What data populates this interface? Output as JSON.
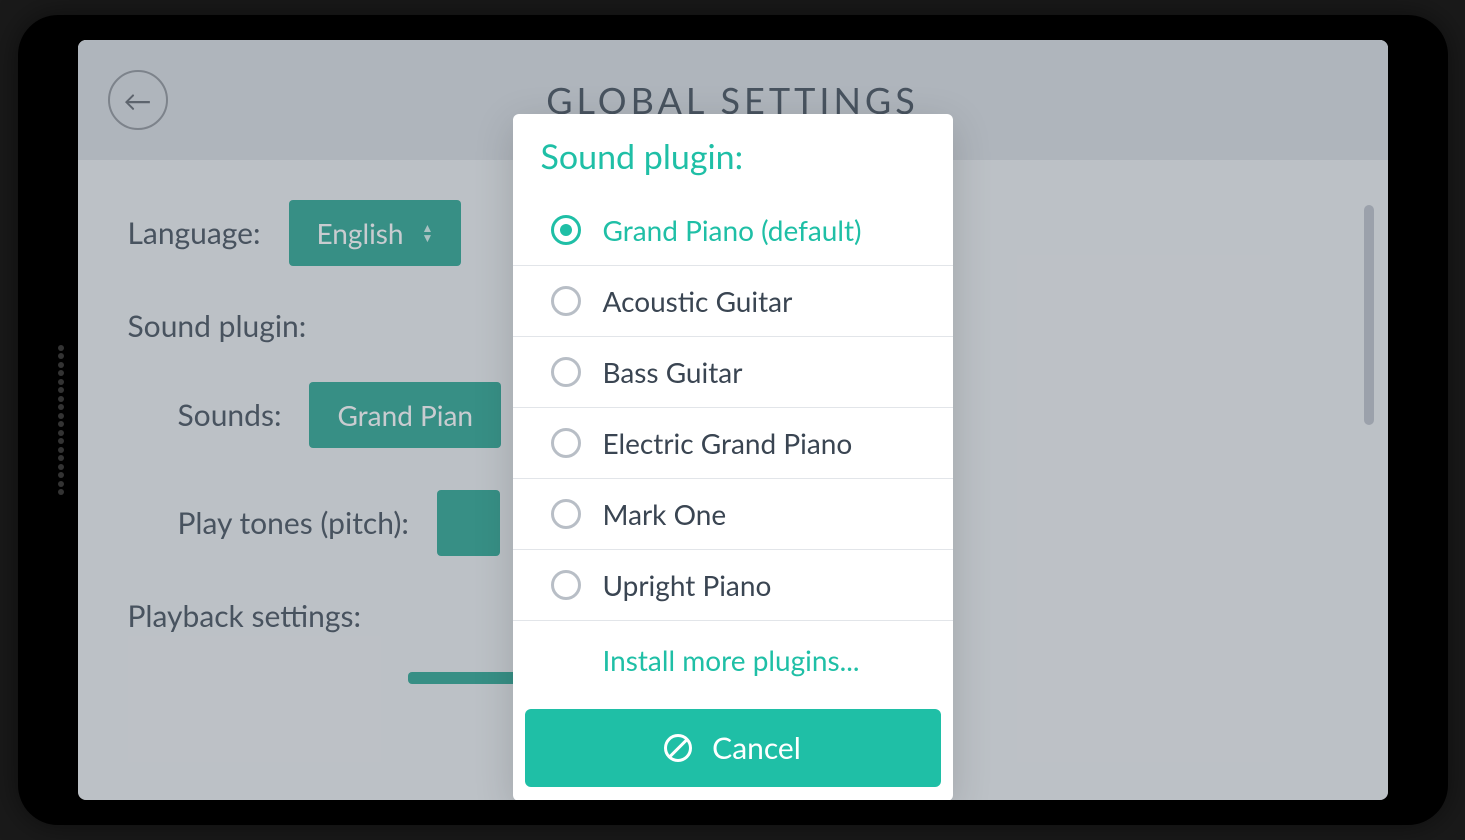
{
  "pageTitle": "GLOBAL SETTINGS",
  "settings": {
    "languageLabel": "Language:",
    "languageValue": "English",
    "soundPluginLabel": "Sound plugin:",
    "soundsLabel": "Sounds:",
    "soundsValue": "Grand Pian",
    "playTonesLabel": "Play tones (pitch):",
    "playbackSettingsLabel": "Playback settings:"
  },
  "modal": {
    "title": "Sound plugin:",
    "options": [
      {
        "label": "Grand Piano (default)",
        "selected": true
      },
      {
        "label": "Acoustic Guitar",
        "selected": false
      },
      {
        "label": "Bass Guitar",
        "selected": false
      },
      {
        "label": "Electric Grand Piano",
        "selected": false
      },
      {
        "label": "Mark One",
        "selected": false
      },
      {
        "label": "Upright Piano",
        "selected": false
      }
    ],
    "installLink": "Install more plugins...",
    "cancelLabel": "Cancel"
  }
}
